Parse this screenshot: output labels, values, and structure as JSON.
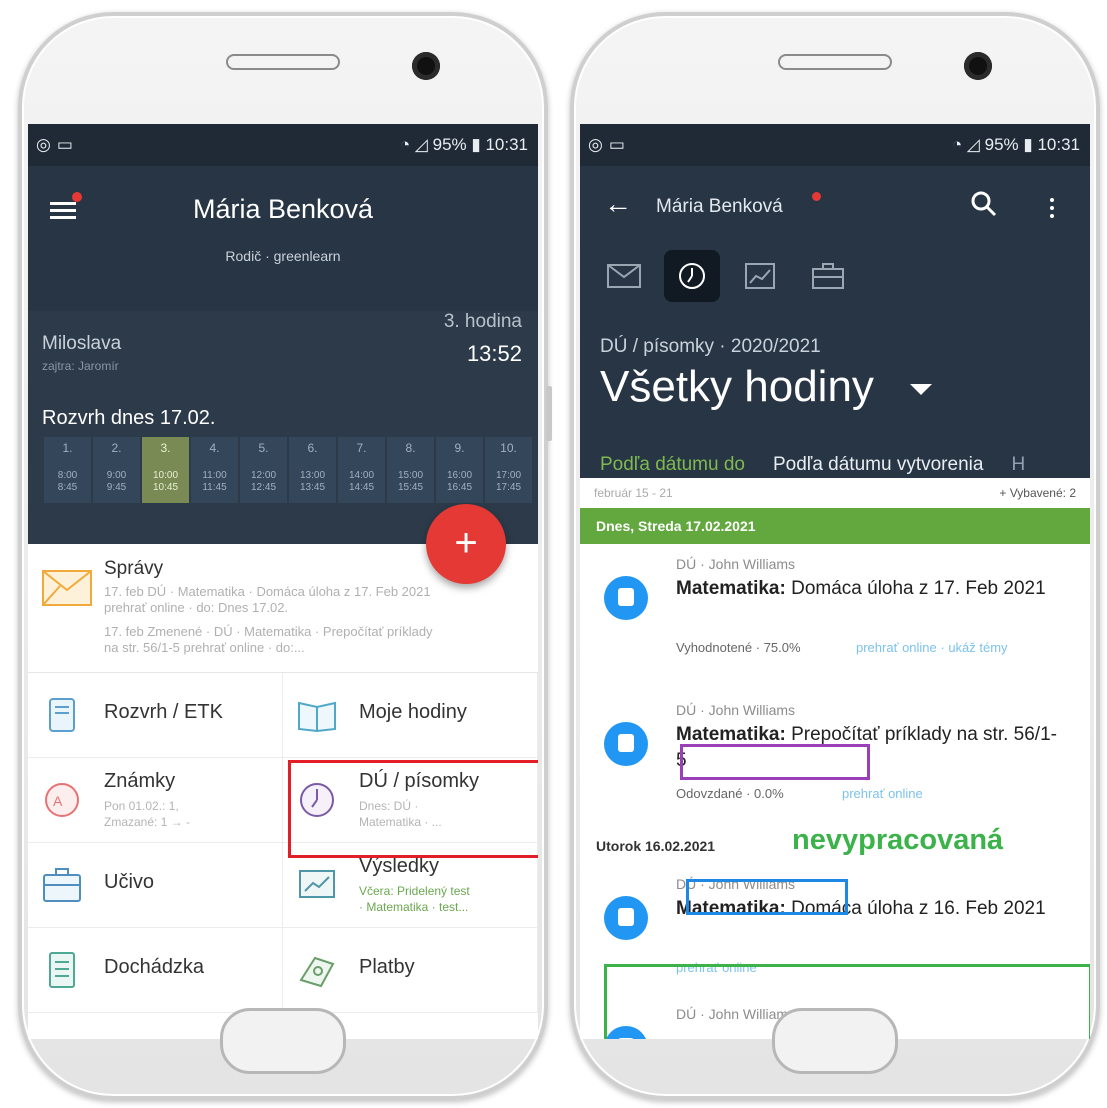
{
  "left": {
    "status": {
      "battery": "95%",
      "time": "10:31"
    },
    "header": {
      "name": "Mária Benková",
      "role": "Rodič · greenlearn"
    },
    "current": {
      "child": "Miloslava",
      "child_sub": "zajtra: Jaromír",
      "hour": "3. hodina",
      "time": "13:52"
    },
    "schedule": {
      "title": "Rozvrh dnes 17.02.",
      "active_index": 2,
      "columns": [
        {
          "n": "1.",
          "t1": "8:00",
          "t2": "8:45"
        },
        {
          "n": "2.",
          "t1": "9:00",
          "t2": "9:45"
        },
        {
          "n": "3.",
          "t1": "10:00",
          "t2": "10:45"
        },
        {
          "n": "4.",
          "t1": "11:00",
          "t2": "11:45"
        },
        {
          "n": "5.",
          "t1": "12:00",
          "t2": "12:45"
        },
        {
          "n": "6.",
          "t1": "13:00",
          "t2": "13:45"
        },
        {
          "n": "7.",
          "t1": "14:00",
          "t2": "14:45"
        },
        {
          "n": "8.",
          "t1": "15:00",
          "t2": "15:45"
        },
        {
          "n": "9.",
          "t1": "16:00",
          "t2": "16:45"
        },
        {
          "n": "10.",
          "t1": "17:00",
          "t2": "17:45"
        }
      ]
    },
    "fab": "+",
    "messages": {
      "title": "Správy",
      "line1": "17. feb   DÚ · Matematika · Domáca úloha z 17. Feb 2021 prehrať online · do: Dnes 17.02.",
      "line2": "17. feb   Zmenené · DÚ · Matematika · Prepočítať príklady na str. 56/1-5 prehrať online · do:..."
    },
    "tiles": {
      "rozvrh": "Rozvrh / ETK",
      "hodiny": "Moje hodiny",
      "znamky": "Známky",
      "znamky_sub": "Pon 01.02.: 1,\nZmazané: 1 → -",
      "du": "DÚ / písomky",
      "du_sub": "Dnes: DÚ ·\nMatematika · ...",
      "ucivo": "Učivo",
      "vysledky": "Výsledky",
      "vysledky_sub": "Včera: Pridelený test\n· Matematika · test...",
      "dochadzka": "Dochádzka",
      "platby": "Platby"
    }
  },
  "right": {
    "status": {
      "battery": "95%",
      "time": "10:31"
    },
    "header": {
      "name": "Mária Benková"
    },
    "breadcrumb": "DÚ / písomky · 2020/2021",
    "title": "Všetky hodiny",
    "tabs": [
      "Podľa dátumu do",
      "Podľa dátumu vytvorenia",
      "H"
    ],
    "filter": {
      "range": "február 15 - 21",
      "selected": "+ Vybavené: 2"
    },
    "day1": "Dnes, Streda 17.02.2021",
    "items": [
      {
        "meta": "DÚ · John Williams",
        "subject": "Matematika:",
        "title": " Domáca úloha z 17. Feb 2021",
        "chip": "Vyhodnotené · 75.0%",
        "links": "prehrať online · ukáž témy"
      },
      {
        "meta": "DÚ · John Williams",
        "subject": "Matematika:",
        "title": " Prepočítať príklady na str. 56/1-5",
        "chip": "Odovzdané · 0.0%",
        "links": "prehrať online"
      },
      {
        "meta": "DÚ · John Williams",
        "subject": "Matematika:",
        "title": " Domáca úloha z 16. Feb 2021",
        "chip": "",
        "links": "prehrať online"
      },
      {
        "meta": "DÚ · John Williams"
      }
    ],
    "day2": "Utorok 16.02.2021",
    "annotation": "nevypracovaná",
    "colors": {
      "purple": "#9b3fb8",
      "blue": "#1e88e5",
      "green": "#3cb24a",
      "red": "#e21f26"
    }
  }
}
